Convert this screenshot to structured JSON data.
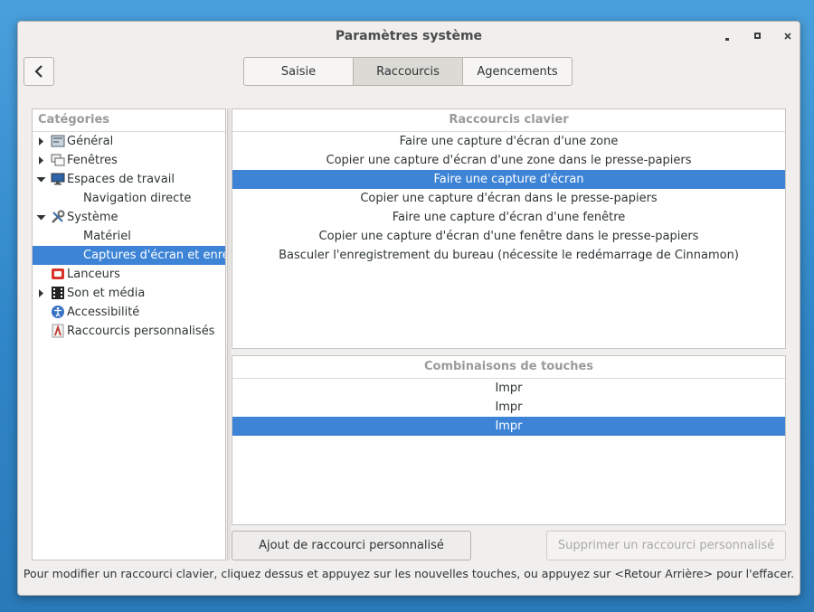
{
  "window": {
    "title": "Paramètres système"
  },
  "tabs": [
    {
      "label": "Saisie",
      "active": false
    },
    {
      "label": "Raccourcis",
      "active": true
    },
    {
      "label": "Agencements",
      "active": false
    }
  ],
  "categories": {
    "header": "Catégories",
    "items": [
      {
        "label": "Général",
        "icon": "general-icon",
        "expander": "collapsed",
        "selected": false
      },
      {
        "label": "Fenêtres",
        "icon": "windows-icon",
        "expander": "collapsed",
        "selected": false
      },
      {
        "label": "Espaces de travail",
        "icon": "workspaces-icon",
        "expander": "expanded",
        "selected": false
      },
      {
        "label": "Navigation directe",
        "sub": true,
        "selected": false
      },
      {
        "label": "Système",
        "icon": "system-tools-icon",
        "expander": "expanded",
        "selected": false
      },
      {
        "label": "Matériel",
        "sub": true,
        "selected": false
      },
      {
        "label": "Captures d'écran et enreg",
        "sub": true,
        "selected": true
      },
      {
        "label": "Lanceurs",
        "icon": "launchers-icon",
        "selected": false
      },
      {
        "label": "Son et média",
        "icon": "sound-media-icon",
        "expander": "collapsed",
        "selected": false
      },
      {
        "label": "Accessibilité",
        "icon": "accessibility-icon",
        "selected": false
      },
      {
        "label": "Raccourcis personnalisés",
        "icon": "custom-shortcuts-icon",
        "selected": false
      }
    ]
  },
  "shortcuts": {
    "header": "Raccourcis clavier",
    "items": [
      {
        "label": "Faire une capture d'écran d'une zone",
        "selected": false
      },
      {
        "label": "Copier une capture d'écran d'une zone dans le presse-papiers",
        "selected": false
      },
      {
        "label": "Faire une capture d'écran",
        "selected": true
      },
      {
        "label": "Copier une capture d'écran dans le presse-papiers",
        "selected": false
      },
      {
        "label": "Faire une capture d'écran d'une fenêtre",
        "selected": false
      },
      {
        "label": "Copier une capture d'écran d'une fenêtre dans le presse-papiers",
        "selected": false
      },
      {
        "label": "Basculer l'enregistrement du bureau (nécessite le redémarrage de Cinnamon)",
        "selected": false
      }
    ]
  },
  "combinations": {
    "header": "Combinaisons de touches",
    "items": [
      {
        "label": "Impr",
        "selected": false
      },
      {
        "label": "Impr",
        "selected": false
      },
      {
        "label": "Impr",
        "selected": true
      }
    ]
  },
  "buttons": {
    "add": "Ajout de raccourci personnalisé",
    "remove": "Supprimer un raccourci personnalisé"
  },
  "hint": "Pour modifier un raccourci clavier, cliquez dessus et appuyez sur les nouvelles touches, ou appuyez sur <Retour Arrière> pour l'effacer.",
  "colors": {
    "selection": "#3d84d6",
    "desktop": "#2f86c8"
  }
}
